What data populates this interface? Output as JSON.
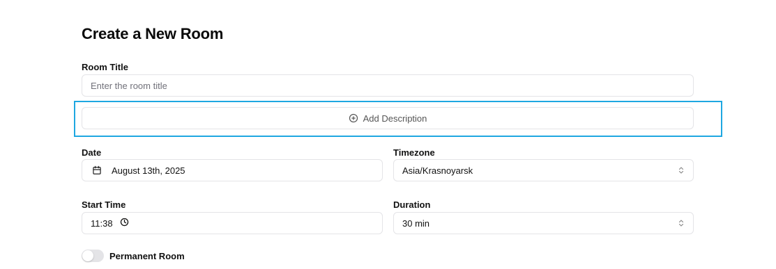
{
  "form": {
    "heading": "Create a New Room",
    "room_title": {
      "label": "Room Title",
      "placeholder": "Enter the room title",
      "value": ""
    },
    "add_description": {
      "label": "Add Description",
      "icon": "plus-circle-icon"
    },
    "date": {
      "label": "Date",
      "value": "August 13th, 2025",
      "icon": "calendar-icon"
    },
    "timezone": {
      "label": "Timezone",
      "value": "Asia/Krasnoyarsk",
      "icon": "chevron-updown-icon"
    },
    "start_time": {
      "label": "Start Time",
      "value": "11:38",
      "icon": "clock-icon"
    },
    "duration": {
      "label": "Duration",
      "value": "30 min",
      "icon": "chevron-updown-icon"
    },
    "permanent_room": {
      "label": "Permanent Room",
      "enabled": false
    }
  },
  "colors": {
    "focus_ring": "#1ea7e1",
    "border": "#e4e4e7",
    "toggle_off": "#e4e4e7"
  }
}
